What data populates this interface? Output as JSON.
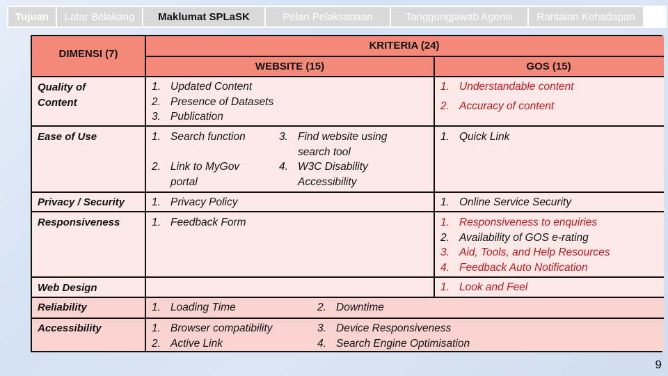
{
  "nav": {
    "tabs": [
      {
        "label": "Tujuan",
        "state": "normal-bold"
      },
      {
        "label": "Latar Belakang",
        "state": "normal"
      },
      {
        "label": "Maklumat SPLaSK",
        "state": "active"
      },
      {
        "label": "Pelan Pelaksanaan",
        "state": "normal"
      },
      {
        "label": "Tanggungjawab Agensi",
        "state": "normal"
      },
      {
        "label": "Rantaian Kehadapan",
        "state": "normal"
      }
    ]
  },
  "table": {
    "dimension_header": "DIMENSI (7)",
    "criteria_header": "KRITERIA (24)",
    "website_header": "WEBSITE (15)",
    "gos_header": "GOS (15)",
    "rows": [
      {
        "dimension": "Quality of\nContent",
        "website": [
          {
            "n": "1.",
            "t": "Updated Content"
          },
          {
            "n": "2.",
            "t": "Presence of Datasets"
          },
          {
            "n": "3.",
            "t": "Publication"
          }
        ],
        "gos": [
          {
            "n": "1.",
            "t": "Understandable content",
            "highlight": true
          },
          {
            "n": "2.",
            "t": "Accuracy of content",
            "highlight": true
          }
        ]
      },
      {
        "dimension": "Ease of Use",
        "website_col_a": [
          {
            "n": "1.",
            "t": "Search function"
          },
          {
            "n": "2.",
            "t": "Link to MyGov\nportal"
          }
        ],
        "website_col_b": [
          {
            "n": "3.",
            "t": "Find website using\nsearch tool"
          },
          {
            "n": "4.",
            "t": "W3C Disability\nAccessibility"
          }
        ],
        "gos": [
          {
            "n": "1.",
            "t": "Quick Link"
          }
        ]
      },
      {
        "dimension": "Privacy / Security",
        "website": [
          {
            "n": "1.",
            "t": "Privacy Policy"
          }
        ],
        "gos": [
          {
            "n": "1.",
            "t": "Online Service Security"
          }
        ]
      },
      {
        "dimension": "Responsiveness",
        "website": [
          {
            "n": "1.",
            "t": "Feedback Form"
          }
        ],
        "gos": [
          {
            "n": "1.",
            "t": "Responsiveness to enquiries",
            "highlight": true
          },
          {
            "n": "2.",
            "t": "Availability of GOS e-rating"
          },
          {
            "n": "3.",
            "t": "Aid, Tools, and Help Resources",
            "highlight": true
          },
          {
            "n": "4.",
            "t": "Feedback Auto Notification",
            "highlight": true
          }
        ]
      },
      {
        "dimension": "Web Design",
        "website": [],
        "gos": [
          {
            "n": "1.",
            "t": "Look and Feel",
            "highlight": true
          }
        ]
      },
      {
        "dimension": "Reliability",
        "combined_col_a": [
          {
            "n": "1.",
            "t": "Loading Time"
          }
        ],
        "combined_col_b": [
          {
            "n": "2.",
            "t": "Downtime"
          }
        ]
      },
      {
        "dimension": "Accessibility",
        "combined_col_a": [
          {
            "n": "1.",
            "t": "Browser compatibility"
          },
          {
            "n": "2.",
            "t": "Active Link"
          }
        ],
        "combined_col_b": [
          {
            "n": "3.",
            "t": "Device Responsiveness"
          },
          {
            "n": "4.",
            "t": "Search Engine Optimisation"
          }
        ]
      }
    ]
  },
  "colors": {
    "header_bg": "#f4897a",
    "cell_bg": "#fdeae8",
    "merged_row_bg": "#f9d3d0",
    "highlight_text": "#c0161d"
  },
  "page_number": "9"
}
